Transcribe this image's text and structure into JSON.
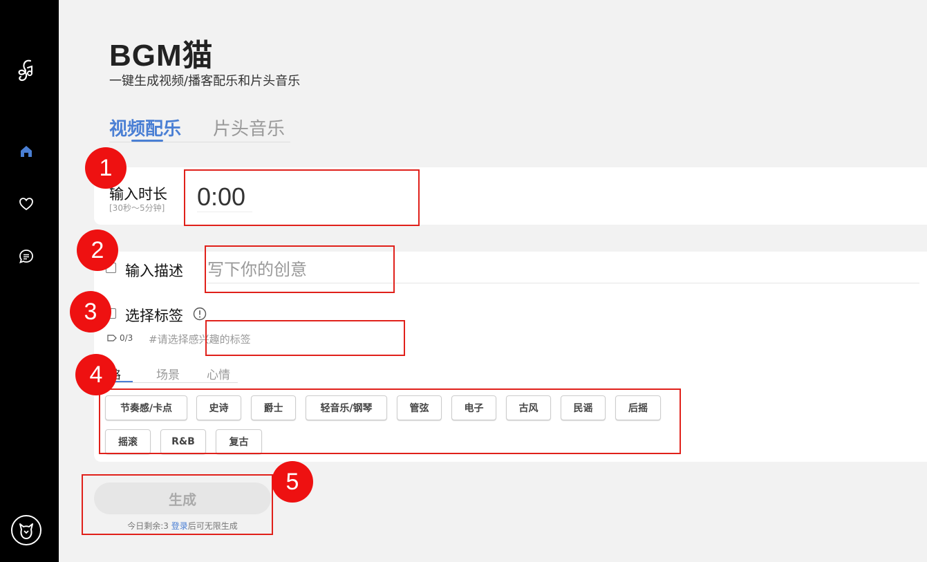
{
  "app": {
    "title": "BGM猫",
    "subtitle": "一键生成视频/播客配乐和片头音乐"
  },
  "tabs": [
    {
      "label": "视频配乐",
      "active": true
    },
    {
      "label": "片头音乐",
      "active": false
    }
  ],
  "duration": {
    "label": "输入时长",
    "hint": "[30秒～5分钟]",
    "value": "0:00"
  },
  "description": {
    "label": "输入描述",
    "placeholder": "写下你的创意"
  },
  "tags": {
    "label": "选择标签",
    "count": "0/3",
    "hint": "#请选择感兴趣的标签",
    "subtabs": [
      {
        "label": "格",
        "active": true
      },
      {
        "label": "场景",
        "active": false
      },
      {
        "label": "心情",
        "active": false
      }
    ],
    "items": [
      "节奏感/卡点",
      "史诗",
      "爵士",
      "轻音乐/钢琴",
      "管弦",
      "电子",
      "古风",
      "民谣",
      "后摇",
      "摇滚",
      "R&B",
      "复古"
    ]
  },
  "generate": {
    "label": "生成",
    "remaining_prefix": "今日剩余:3 ",
    "login": "登录",
    "remaining_suffix": "后可无限生成"
  },
  "annotations": [
    "1",
    "2",
    "3",
    "4",
    "5"
  ],
  "colors": {
    "accent": "#4a7fd4",
    "sidebar": "#000000",
    "annotation": "#ee1111",
    "background": "#f2f2f2"
  },
  "icons": {
    "sidebar": [
      "logo-icon",
      "home-icon",
      "heart-icon",
      "chat-icon",
      "cat-avatar-icon"
    ]
  }
}
